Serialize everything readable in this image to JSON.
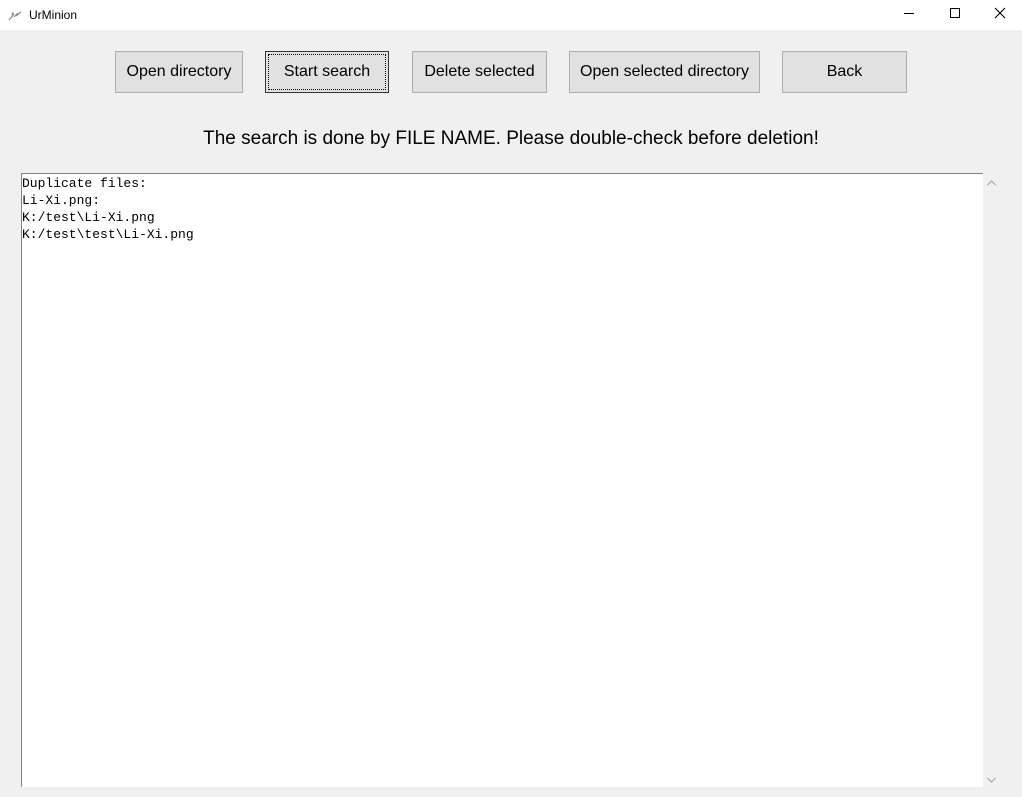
{
  "window": {
    "title": "UrMinion",
    "icon": "feather-icon",
    "controls": [
      "minimize-icon",
      "maximize-icon",
      "close-icon"
    ]
  },
  "toolbar": {
    "open_directory_label": "Open directory",
    "start_search_label": "Start search",
    "delete_selected_label": "Delete selected",
    "open_selected_directory_label": "Open selected directory",
    "back_label": "Back"
  },
  "notice": "The search is done by FILE NAME. Please double-check before deletion!",
  "output": {
    "lines": [
      "Duplicate files:",
      "Li-Xi.png:",
      "K:/test\\Li-Xi.png",
      "K:/test\\test\\Li-Xi.png"
    ]
  }
}
